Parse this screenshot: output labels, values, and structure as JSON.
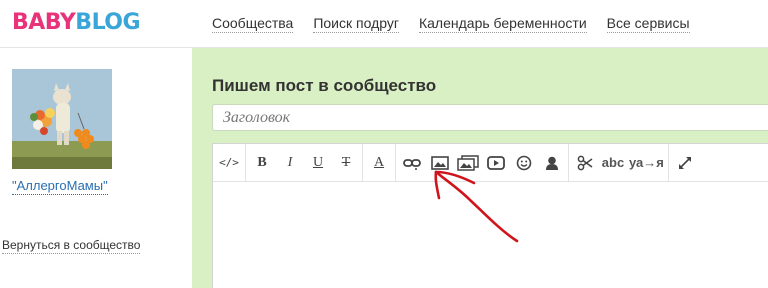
{
  "header": {
    "logo_part1": "BABY",
    "logo_part2": "BLOG",
    "nav": [
      {
        "label": "Сообщества"
      },
      {
        "label": "Поиск подруг"
      },
      {
        "label": "Календарь беременности"
      },
      {
        "label": "Все сервисы"
      }
    ]
  },
  "sidebar": {
    "community_name": "\"АллергоМамы\"",
    "back_link": "Вернуться в сообщество"
  },
  "main": {
    "title": "Пишем пост в сообщество",
    "title_input_placeholder": "Заголовок",
    "toolbar": {
      "code": "</>",
      "bold": "B",
      "italic": "I",
      "underline": "U",
      "strike": "T",
      "text_color": "A",
      "spellcheck": "abc",
      "transliterate": "уа→я"
    }
  },
  "annotation": {
    "arrow_color": "#d0141c"
  }
}
